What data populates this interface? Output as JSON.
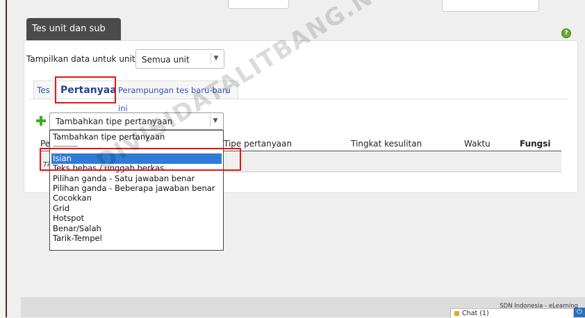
{
  "block": {
    "title": "Tes unit dan sub unit"
  },
  "filter": {
    "label": "Tampilkan data untuk unit:",
    "selected": "Semua unit"
  },
  "tabs": [
    {
      "label": "Tes"
    },
    {
      "label": "Pertanyaan",
      "active": true
    },
    {
      "label": "Perampungan tes baru-baru ini"
    }
  ],
  "add_question": {
    "selected": "Tambahkan tipe pertanyaan",
    "options": [
      "Tambahkan tipe pertanyaan",
      "---------------",
      "Isian",
      "Teks bebas / unggah berkas",
      "Pilihan ganda - Satu jawaban benar",
      "Pilihan ganda - Beberapa jawaban benar",
      "Cocokkan",
      "Grid",
      "Hotspot",
      "Benar/Salah",
      "Tarik-Tempel"
    ],
    "highlighted_index": 2
  },
  "table": {
    "headers": [
      "Pe",
      "Tipe pertanyaan",
      "Tingkat kesulitan",
      "Waktu",
      "Fungsi"
    ],
    "row_fragment": "Ti"
  },
  "watermark": "DIVISIDATALITBANG.NET",
  "footer": {
    "text": "SDN Indonesia - eLearning"
  },
  "chat": {
    "label": "Chat (1)"
  },
  "colors": {
    "accent": "#2f7cd6",
    "highlight_box": "#e01515",
    "tab_active": "#2a3f8f"
  }
}
